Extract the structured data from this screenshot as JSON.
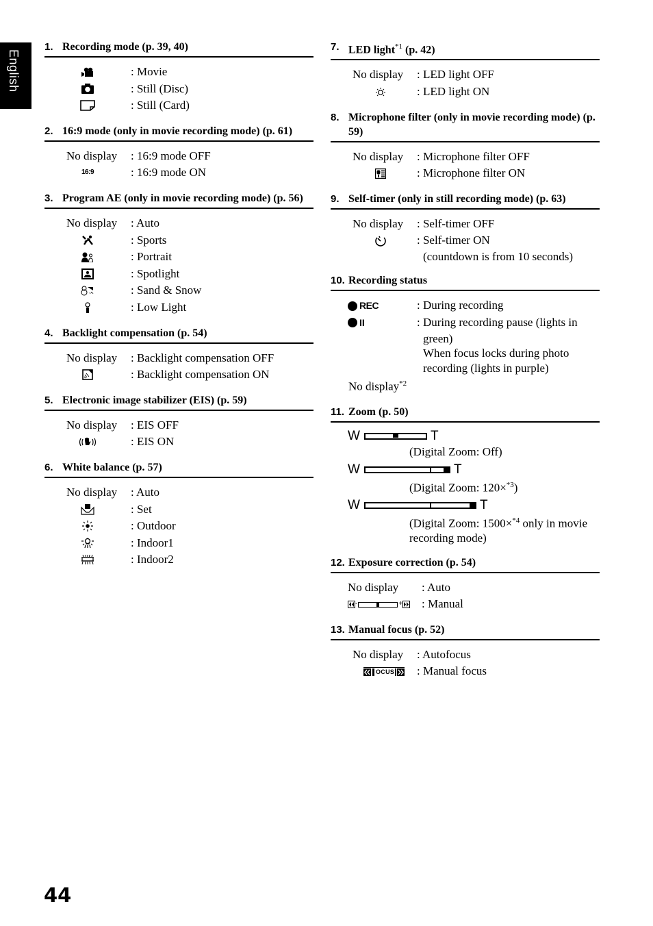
{
  "language_tab": "English",
  "page_number": "44",
  "left_column": [
    {
      "num": "1.",
      "title": "Recording mode (p. 39, 40)",
      "rows": [
        {
          "icon": "movie-icon",
          "value": ": Movie"
        },
        {
          "icon": "camera-icon",
          "value": ": Still (Disc)"
        },
        {
          "icon": "card-icon",
          "value": ": Still (Card)"
        }
      ]
    },
    {
      "num": "2.",
      "title": "16:9 mode (only in movie recording mode) (p. 61)",
      "rows": [
        {
          "key": "No display",
          "value": ": 16:9 mode OFF"
        },
        {
          "icon": "wide-16-9-icon",
          "icon_text": "16:9",
          "value": ": 16:9 mode ON"
        }
      ]
    },
    {
      "num": "3.",
      "title": "Program AE (only in movie recording mode) (p. 56)",
      "rows": [
        {
          "key": "No display",
          "value": ": Auto"
        },
        {
          "icon": "sports-icon",
          "value": ": Sports"
        },
        {
          "icon": "portrait-icon",
          "value": ": Portrait"
        },
        {
          "icon": "spotlight-icon",
          "value": ": Spotlight"
        },
        {
          "icon": "sand-snow-icon",
          "value": ": Sand & Snow"
        },
        {
          "icon": "low-light-icon",
          "value": ": Low Light"
        }
      ]
    },
    {
      "num": "4.",
      "title": "Backlight compensation (p. 54)",
      "rows": [
        {
          "key": "No display",
          "value": ": Backlight compensation OFF"
        },
        {
          "icon": "backlight-icon",
          "value": ": Backlight compensation ON"
        }
      ]
    },
    {
      "num": "5.",
      "title": "Electronic image stabilizer (EIS) (p. 59)",
      "rows": [
        {
          "key": "No display",
          "value": ": EIS OFF"
        },
        {
          "icon": "eis-hand-icon",
          "value": ": EIS ON"
        }
      ]
    },
    {
      "num": "6.",
      "title": "White balance (p. 57)",
      "rows": [
        {
          "key": "No display",
          "value": ": Auto"
        },
        {
          "icon": "wb-set-icon",
          "value": ": Set"
        },
        {
          "icon": "sun-icon",
          "value": ": Outdoor"
        },
        {
          "icon": "bulb-icon",
          "value": ": Indoor1"
        },
        {
          "icon": "fluorescent-icon",
          "value": ": Indoor2"
        }
      ]
    }
  ],
  "right_column": {
    "s7": {
      "num": "7.",
      "title": "LED light",
      "title_sup": "*1",
      "title_after": " (p. 42)",
      "rows": [
        {
          "key": "No display",
          "value": ": LED light OFF"
        },
        {
          "icon": "led-light-icon",
          "value": ": LED light ON"
        }
      ]
    },
    "s8": {
      "num": "8.",
      "title": "Microphone filter (only in movie recording mode) (p. 59)",
      "rows": [
        {
          "key": "No display",
          "value": ": Microphone filter OFF"
        },
        {
          "icon": "mic-filter-icon",
          "value": ": Microphone filter ON"
        }
      ]
    },
    "s9": {
      "num": "9.",
      "title": "Self-timer (only in still recording mode) (p. 63)",
      "rows": [
        {
          "key": "No display",
          "value": ": Self-timer OFF"
        },
        {
          "icon": "self-timer-icon",
          "value": ": Self-timer ON",
          "cont": "(countdown is from 10 seconds)"
        }
      ]
    },
    "s10": {
      "num": "10.",
      "title": "Recording status",
      "rows": [
        {
          "icon": "rec-icon",
          "icon_text": "REC",
          "value": ": During recording"
        },
        {
          "icon": "rec-pause-icon",
          "icon_text": "II",
          "value": ": During recording pause (lights in",
          "cont": "green)",
          "cont2": "When focus locks during photo",
          "cont3": "recording (lights in purple)"
        }
      ],
      "footer_key": "No display",
      "footer_sup": "*2"
    },
    "s11": {
      "num": "11.",
      "title": "Zoom (p. 50)",
      "wide_label": "W",
      "tele_label": "T",
      "bars": [
        {
          "position": 0.5,
          "caption": "(Digital Zoom: Off)"
        },
        {
          "position": 1.0,
          "caption": "(Digital Zoom: 120×",
          "caption_sup": "*3",
          "caption_after": ")"
        },
        {
          "position": 1.0,
          "caption": "(Digital Zoom: 1500×",
          "caption_sup": "*4",
          "caption_after": " only in movie",
          "caption_cont": "recording mode)"
        }
      ]
    },
    "s12": {
      "num": "12.",
      "title": "Exposure correction (p. 54)",
      "rows": [
        {
          "key": "No display",
          "value": ": Auto"
        },
        {
          "icon": "exposure-bar-icon",
          "minus": "-",
          "plus": "+",
          "level": 0.5,
          "value": ": Manual"
        }
      ]
    },
    "s13": {
      "num": "13.",
      "title": "Manual focus (p. 52)",
      "rows": [
        {
          "key": "No display",
          "value": ": Autofocus"
        },
        {
          "icon": "manual-focus-icon",
          "icon_text": "OCUS",
          "value": ": Manual focus"
        }
      ]
    }
  }
}
